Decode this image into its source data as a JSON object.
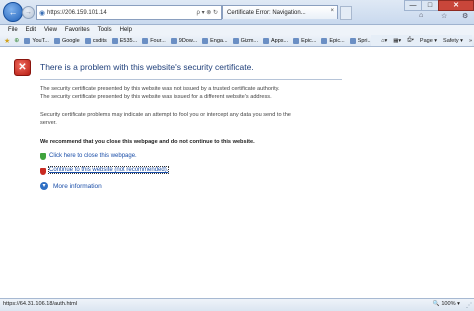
{
  "address_bar": {
    "url": "https://206.159.101.14",
    "controls": "ρ ▾ ⊗ ↻"
  },
  "tab": {
    "title": "Certificate Error: Navigation...",
    "close": "×"
  },
  "window_controls": {
    "minimize": "—",
    "maximize": "□",
    "close": "✕"
  },
  "menu": {
    "items": [
      "File",
      "Edit",
      "View",
      "Favorites",
      "Tools",
      "Help"
    ]
  },
  "favorites_bar": {
    "items": [
      "YouT...",
      "Google",
      "csdits",
      "E535...",
      "Four...",
      "9Dow...",
      "Enga...",
      "Gizm...",
      "Apps...",
      "Epic...",
      "Epic...",
      "Spri..."
    ],
    "page_label": "Page ▾",
    "safety_label": "Safety ▾",
    "tools_label": "»"
  },
  "page": {
    "heading": "There is a problem with this website's security certificate.",
    "para1_line1": "The security certificate presented by this website was not issued by a trusted certificate authority.",
    "para1_line2": "The security certificate presented by this website was issued for a different website's address.",
    "para2_line1": "Security certificate problems may indicate an attempt to fool you or intercept any data you send to the",
    "para2_line2": "server.",
    "recommendation": "We recommend that you close this webpage and do not continue to this website.",
    "close_link": "Click here to close this webpage.",
    "continue_link": "Continue to this website (not recommended).",
    "more_info": "More information"
  },
  "status_bar": {
    "url": "https://64.31.106.18/auth.html",
    "zoom": "100%"
  }
}
